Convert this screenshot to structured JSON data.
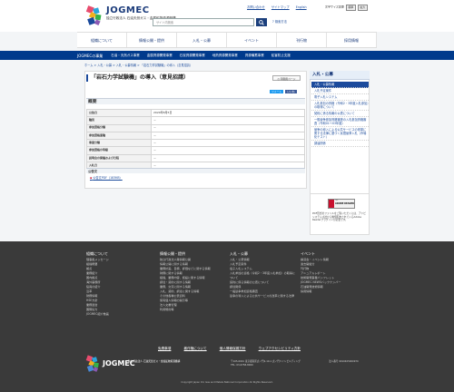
{
  "header": {
    "logo_text": "JOGMEC",
    "logo_sub": "独立行政法人 石油天然ガス・金属鉱物資源機構",
    "top_links": [
      "お問い合わせ",
      "サイトマップ",
      "English",
      "ENG"
    ],
    "font_size_label": "文字サイズ変更",
    "font_buttons": [
      "標準",
      "拡大"
    ],
    "lang_buttons": [
      "日本語",
      "English"
    ],
    "search_placeholder": "サイト内検索",
    "search_icon": "magnifier-icon",
    "keyword_link": "検索方法"
  },
  "main_nav": [
    "組織について",
    "情報公開・提供",
    "入札・公募",
    "イベント",
    "刊行物",
    "採用情報"
  ],
  "sub_nav": {
    "title": "JOGMECの事業",
    "items": [
      "石油・天然ガス事業",
      "金属資源開発事業",
      "石炭資源開発事業",
      "地熱資源開発事業",
      "資源備蓄事業",
      "鉱害防止支援"
    ]
  },
  "breadcrumb": "ホーム > 入札・公募 > 入札・公募情報 > 「岩石力学試験機」の導入（意見招請）",
  "article": {
    "title": "「岩石力学試験機」の導入（意見招請）",
    "print_label": "印刷用ページ",
    "share": [
      "ツイート",
      "いいね"
    ],
    "section_heading": "概要",
    "table": [
      {
        "k": "公告日",
        "v": "2020年8月5日"
      },
      {
        "k": "種別",
        "v": "－"
      },
      {
        "k": "参加資格分類",
        "v": "－"
      },
      {
        "k": "参加資格業種",
        "v": "－"
      },
      {
        "k": "事業分類",
        "v": "－"
      },
      {
        "k": "参加資格の等級",
        "v": "－"
      },
      {
        "k": "説明会の開催および日程",
        "v": "－"
      },
      {
        "k": "入札日",
        "v": "－"
      }
    ],
    "attachments_heading": "公告文",
    "attachment": "公告文PDF（183KB）"
  },
  "sidebar": {
    "heading": "入札・公募",
    "items": [
      {
        "label": "入札・公募情報",
        "active": true
      },
      {
        "label": "入札予定案件",
        "active": false
      },
      {
        "label": "電子入札システム",
        "active": false
      },
      {
        "label": "入札参加の資格（令和2・3年度入札参加）の取得について",
        "active": false
      },
      {
        "label": "契約に係る情報の公表について",
        "active": false
      },
      {
        "label": "一般競争参加資格審査の入札参加資格審査（令和01～03年度）",
        "active": false
      },
      {
        "label": "競争の導入による公共サービスの改革に関する法律に基づく民間競争入札（市場化テスト）",
        "active": false
      },
      {
        "label": "調達関係",
        "active": false
      }
    ]
  },
  "adobe": {
    "badge_top": "Get",
    "badge_name": "ADOBE READER",
    "desc": "PDF形式のファイルをご覧いただくには、アドビシステムズ社から無償配布されているAdobe Readerプラグインが必要です。"
  },
  "footer": {
    "col1": {
      "heading": "組織について",
      "items": [
        "理事長メッセージ",
        "組織概要",
        "拠点",
        "業務紹介",
        "国内拠点",
        "海外事務所",
        "役員の紹介",
        "沿革",
        "財務情報",
        "HSE方針",
        "業務運営",
        "国際協力",
        "JOGMEC紹介動画"
      ]
    },
    "col2": {
      "heading": "情報公開・提供",
      "items": [
        "独立行政法人等情報公開",
        "情報公開に関する情報",
        "業務計画、目標、評価などに関する情報",
        "財務に関する情報",
        "組織、業務内容、施設に関する情報",
        "調達・契約に関する情報",
        "業務、交流に関する情報",
        "入札、契約、調達に関する情報",
        "その他各種公表資料",
        "保有個人情報の開示等",
        "法人文書管理",
        "利用規約等"
      ]
    },
    "col3": {
      "heading": "入札・公募",
      "items": [
        "入札・公募情報",
        "入札予定案件",
        "電子入札システム",
        "入札参加の資格（令和2・3年度入札参加）の取得について",
        "契約に係る情報の公表について",
        "調達関係",
        "一般競争参加資格審査",
        "競争の導入による公共サービスの改革に関する法律"
      ]
    },
    "col4": {
      "heading": "イベント",
      "items": [
        "講演会・イベント情報",
        "過去開催分",
        "刊行物",
        "アニュアルレポート",
        "技術開発事業パンフレット",
        "JOGMEC NEWSバックナンバー",
        "石油開発技術情報",
        "採用情報"
      ]
    },
    "bottom_links": [
      "免責事項",
      "著作権について",
      "個人情報保護方針",
      "ウェブアクセシビリティ方針"
    ],
    "logo_text": "JOGMEC",
    "logo_sub": "独立行政法人 石油天然ガス・金属鉱物資源機構",
    "address": "〒105-0001 東京都港区虎ノ門2-10-1 虎ノ門ツインビルディング",
    "tel": "TEL: 03-6758-8000",
    "corp_number": "法人番号 9010405000970",
    "copyright": "Copyright Japan Oil, Gas and Metals National Corporation All Rights Reserved."
  }
}
